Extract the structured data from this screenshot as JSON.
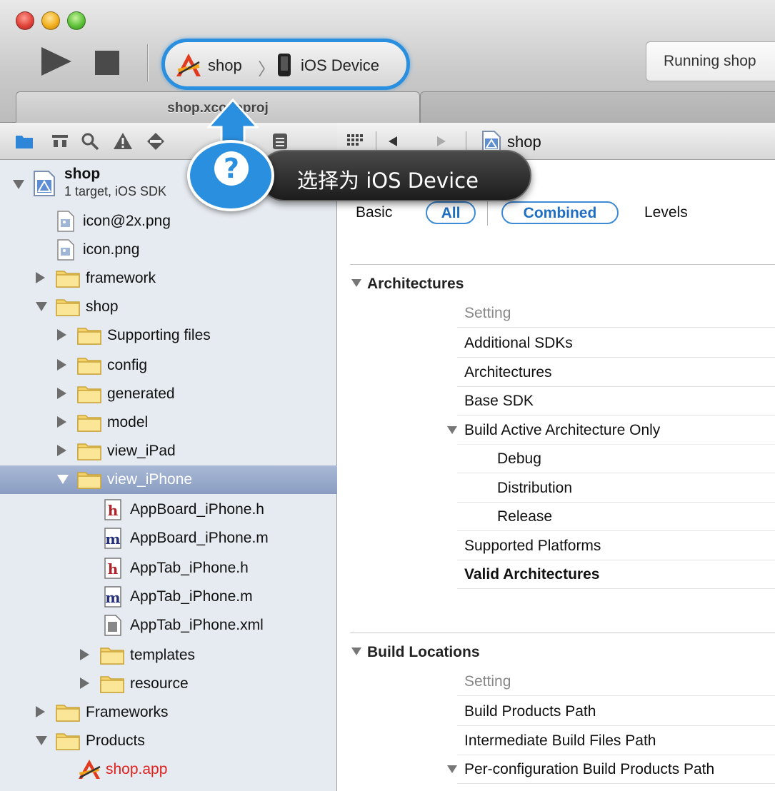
{
  "toolbar": {
    "scheme_name": "shop",
    "scheme_separator": "〉",
    "device_name": "iOS Device",
    "activity_text": "Running shop"
  },
  "tab": {
    "active_title": "shop.xcodeproj"
  },
  "callout": {
    "question_mark": "?",
    "text": "选择为 iOS Device",
    "accent_color": "#2b8fdf"
  },
  "navigator": {
    "project": {
      "name": "shop",
      "subtitle": "1 target, iOS SDK"
    },
    "items": [
      {
        "label": "icon@2x.png",
        "kind": "image-file"
      },
      {
        "label": "icon.png",
        "kind": "image-file"
      },
      {
        "label": "framework",
        "kind": "folder"
      },
      {
        "label": "shop",
        "kind": "folder"
      },
      {
        "label": "Supporting files",
        "kind": "folder"
      },
      {
        "label": "config",
        "kind": "folder"
      },
      {
        "label": "generated",
        "kind": "folder"
      },
      {
        "label": "model",
        "kind": "folder"
      },
      {
        "label": "view_iPad",
        "kind": "folder"
      },
      {
        "label": "view_iPhone",
        "kind": "folder",
        "selected": true
      },
      {
        "label": "AppBoard_iPhone.h",
        "kind": "header-file"
      },
      {
        "label": "AppBoard_iPhone.m",
        "kind": "source-file"
      },
      {
        "label": "AppTab_iPhone.h",
        "kind": "header-file"
      },
      {
        "label": "AppTab_iPhone.m",
        "kind": "source-file"
      },
      {
        "label": "AppTab_iPhone.xml",
        "kind": "xml-file"
      },
      {
        "label": "templates",
        "kind": "folder"
      },
      {
        "label": "resource",
        "kind": "folder"
      },
      {
        "label": "Frameworks",
        "kind": "folder"
      },
      {
        "label": "Products",
        "kind": "folder"
      },
      {
        "label": "shop.app",
        "kind": "app-product"
      }
    ]
  },
  "editor": {
    "jump_bar_label": "shop",
    "filters": {
      "basic": "Basic",
      "all": "All",
      "combined": "Combined",
      "levels": "Levels"
    },
    "sections": [
      {
        "title": "Architectures",
        "header": "Setting",
        "rows": [
          "Additional SDKs",
          "Architectures",
          "Base SDK",
          "Build Active Architecture Only",
          "Debug",
          "Distribution",
          "Release",
          "Supported Platforms",
          "Valid Architectures"
        ]
      },
      {
        "title": "Build Locations",
        "header": "Setting",
        "rows": [
          "Build Products Path",
          "Intermediate Build Files Path",
          "Per-configuration Build Products Path"
        ]
      }
    ]
  }
}
